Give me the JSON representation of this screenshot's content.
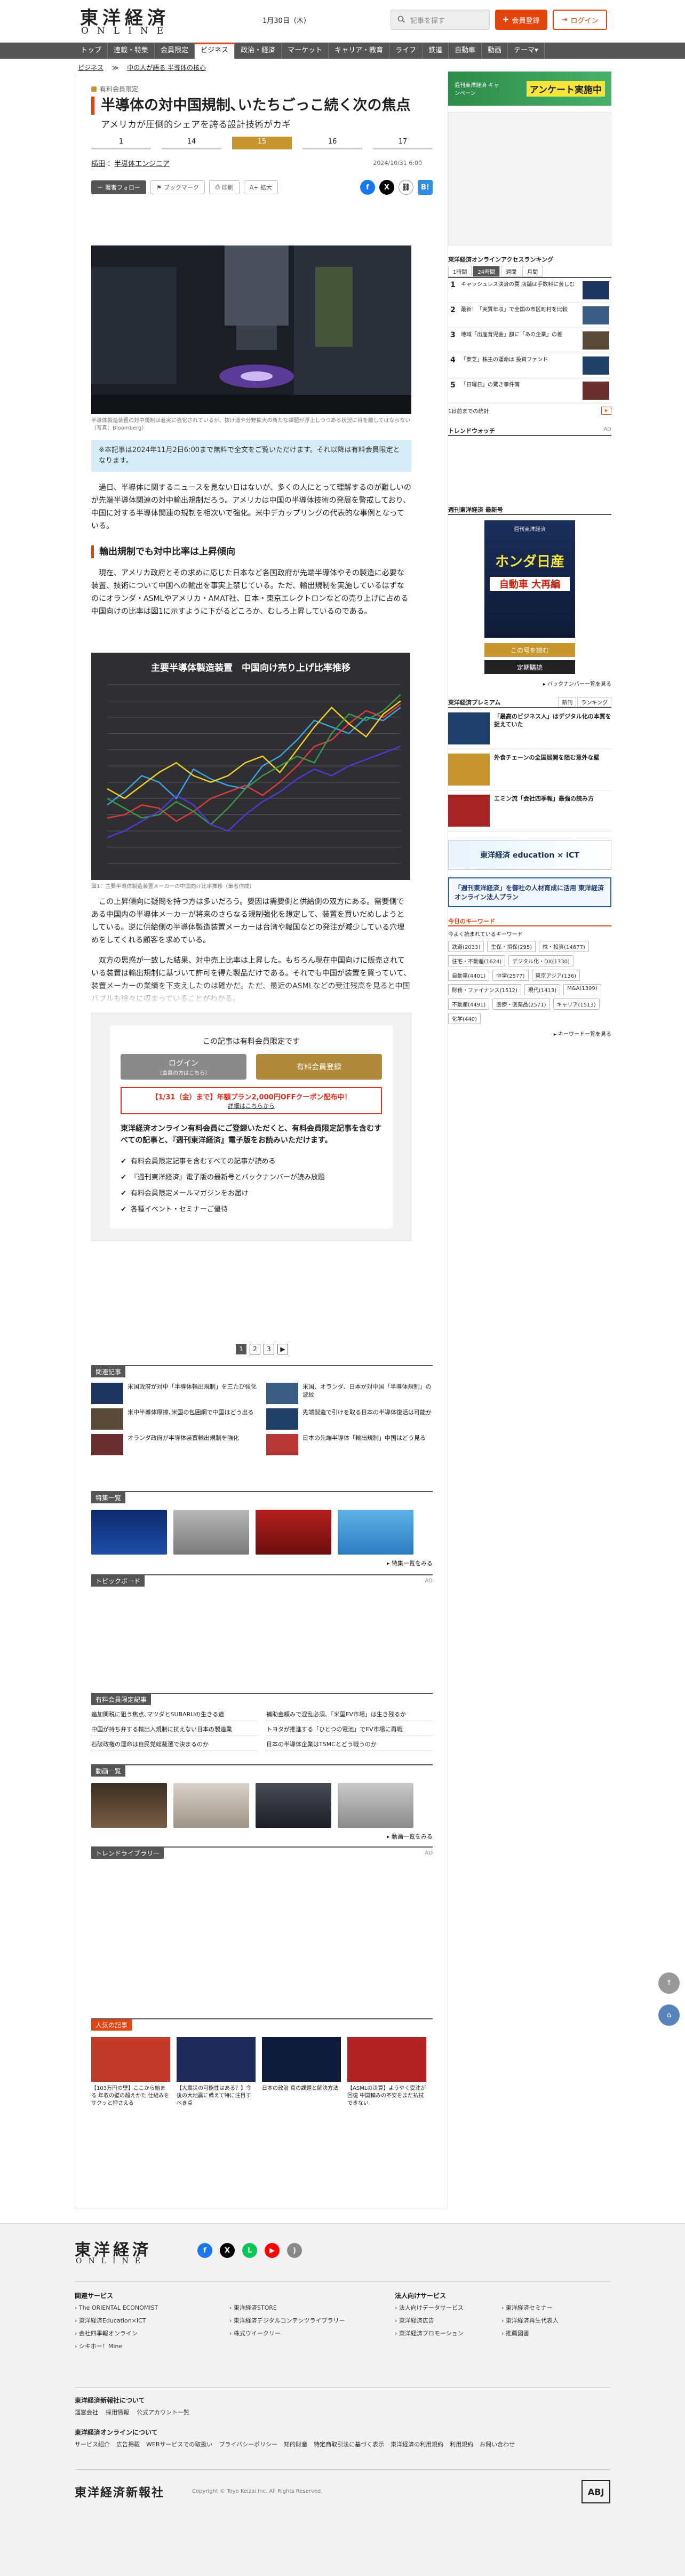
{
  "header": {
    "logo_main": "東洋経済",
    "logo_sub": "ONLINE",
    "date": "1月30日（木）",
    "search_placeholder": "記事を探す",
    "register_label": "会員登録",
    "login_label": "ログイン"
  },
  "nav": [
    "トップ",
    "連載・特集",
    "会員限定",
    "ビジネス",
    "政治・経済",
    "マーケット",
    "キャリア・教育",
    "ライフ",
    "鉄道",
    "自動車",
    "動画",
    "テーマ▾"
  ],
  "nav_active": "ビジネス",
  "breadcrumb": [
    "ビジネス",
    "≫",
    "中の人が語る 半導体の核心"
  ],
  "article": {
    "kicker": "有料会員限定",
    "title_line1": "半導体の対中国規制､いたちごっこ続く次の焦点",
    "subtitle": "アメリカが圧倒的シェアを誇る設計技術がカギ",
    "pages": [
      "1",
      "14",
      "15",
      "16",
      "17"
    ],
    "page_active": "15",
    "author_prefix": "横田",
    "author_name": "半導体エンジニア",
    "date": "2024/10/31 6:00",
    "follow_label": "著者フォロー",
    "bookmark_label": "ブックマーク",
    "print_label": "印刷",
    "textsize_label": "A+ 拡大",
    "photo_caption": "半導体製造装置の対中規制は着実に強化されているが、抜け道や分野拡大の新たな課題が浮上しつつある状況に目を離してはならない（写真：Bloomberg）",
    "note": "※本記事は2024年11月2日6:00まで無料で全文をご覧いただけます。それ以降は有料会員限定となります。",
    "para1": "過日、半導体に関するニュースを見ない日はないが、多くの人にとって理解するのが難しいのが先端半導体関連の対中輸出規制だろう。アメリカは中国の半導体技術の発展を警戒しており、中国に対する半導体関連の規制を相次いで強化。米中デカップリングの代表的な事例となっている。",
    "h2": "輸出規制でも対中比率は上昇傾向",
    "para2": "現在、アメリカ政府とその求めに応じた日本など各国政府が先端半導体やその製造に必要な装置、技術について中国への輸出を事実上禁じている。ただ、輸出規制を実施しているはずなのにオランダ・ASMLやアメリカ・AMAT社、日本・東京エレクトロンなどの売り上げに占める中国向けの比率は図1に示すように下がるどころか、むしろ上昇しているのである。",
    "para3": "この上昇傾向に疑問を持つ方は多いだろう。要因は需要側と供給側の双方にある。需要側である中国内の半導体メーカーが将来のさらなる規制強化を想定して、装置を買いだめしようとしている。逆に供給側の半導体製造装置メーカーは台湾や韓国などの発注が減少している穴埋めをしてくれる顧客を求めている。",
    "para4": "双方の思惑が一致した結果、対中売上比率は上昇した。もちろん現在中国向けに販売されている装置は輸出規制に基づいて許可を得た製品だけである。それでも中国が装置を買っていて、装置メーカーの業績を下支えしたのは確かだ。ただ、最近のASMLなどの受注残高を見ると中国バブルも徐々に収まっていることがわかる。"
  },
  "chart_data": {
    "type": "line",
    "title": "主要半導体製造装置　中国向け売り上げ比率推移",
    "caption": "図1：主要半導体製造装置メーカーの中国向け比率推移（筆者作成）",
    "series": [
      {
        "name": "",
        "color": "#3ba3e0",
        "values": [
          18,
          22,
          27,
          25,
          20,
          29,
          26,
          24,
          23,
          30,
          33,
          38,
          44,
          42,
          40,
          45,
          44,
          48
        ]
      },
      {
        "name": "",
        "color": "#e03c3c",
        "values": [
          14,
          15,
          18,
          17,
          13,
          16,
          20,
          22,
          24,
          21,
          25,
          30,
          36,
          38,
          43,
          47,
          45,
          49
        ]
      },
      {
        "name": "",
        "color": "#f2d21b",
        "values": [
          23,
          20,
          24,
          28,
          31,
          27,
          25,
          27,
          31,
          33,
          28,
          35,
          42,
          48,
          43,
          39,
          46,
          50
        ]
      },
      {
        "name": "",
        "color": "#3b9a45",
        "values": [
          20,
          17,
          14,
          15,
          19,
          16,
          12,
          17,
          23,
          27,
          30,
          33,
          31,
          40,
          46,
          44,
          47,
          52
        ]
      },
      {
        "name": "",
        "color": "#4b3bd8",
        "values": [
          8,
          10,
          13,
          16,
          21,
          18,
          12,
          10,
          15,
          19,
          22,
          26,
          29,
          27,
          30,
          32,
          34,
          36
        ]
      }
    ],
    "grid": true
  },
  "paywall": {
    "heading": "この記事は有料会員限定です",
    "login_label": "ログイン",
    "login_sub": "（会員の方はこちら）",
    "register_label": "有料会員登録",
    "promo": "【1/31（金）まで】年額プラン2,000円OFFクーポン配布中！",
    "promo_sub": "詳細はこちらから",
    "lead": "東洋経済オンライン有料会員にご登録いただくと、有料会員限定記事を含むすべての記事と、『週刊東洋経済』電子版をお読みいただけます。",
    "benefits": [
      "有料会員限定記事を含むすべての記事が読める",
      "『週刊東洋経済』電子版の最新号とバックナンバーが読み放題",
      "有料会員限定メールマガジンをお届け",
      "各種イベント・セミナーご優待"
    ]
  },
  "pagination": [
    "1",
    "2",
    "3",
    "▶"
  ],
  "related": {
    "heading": "関連記事",
    "items": [
      "米国政府が対中「半導体輸出規制」を三たび強化",
      "米国、オランダ、日本が対中国「半導体規制」の波紋",
      "米中半導体摩擦､米国の包囲網で中国はどう出る",
      "先端製造で引けを取る日本の半導体復活は可能か",
      "オランダ政府が半導体装置輸出規制を強化",
      "日本の先端半導体「輸出規制」中国はどう見る"
    ]
  },
  "feature": {
    "heading": "特集一覧",
    "more": "特集一覧をみる"
  },
  "topics": {
    "heading": "トピックボード",
    "ad": "AD"
  },
  "paid": {
    "heading": "有料会員限定記事",
    "items": [
      "追加関税に狙う焦点､マツダとSUBARUの生きる道",
      "補助金頼みで混乱必須､「米国EV市場」は生き残るか",
      "中国が持ち弁する輸出入規制に抗えない日本の製造業",
      "トヨタが推進する「ひとつの電池」でEV市場に再戦",
      "石破政権の運命は自民党総裁選で決まるのか",
      "日本の半導体企業はTSMCとどう戦うのか"
    ]
  },
  "video": {
    "heading": "動画一覧",
    "more": "動画一覧をみる"
  },
  "trend": {
    "heading": "トレンドライブラリー",
    "ad": "AD"
  },
  "popular": {
    "heading": "人気の記事",
    "items": [
      "【103万円の壁】ここから始まる 年収の壁の超えかた 仕組みをサクッと押さえる",
      "【大震災の可能性はある？】今後の大地震に備えて特に注目すべき点",
      "日本の政治 真の課題と解決方法",
      "【ASMLの決算】ようやく受注が回復 中国頼みの不安をまだ払拭できない"
    ]
  },
  "sidebar": {
    "ad_banner": "アンケート実施中",
    "ad_banner_sub": "週刊東洋経済 キャンペーン",
    "ranking_heading": "東洋経済オンラインアクセスランキング",
    "ranking_tabs": [
      "1時間",
      "24時間",
      "週間",
      "月間"
    ],
    "ranking": [
      "キャッシュレス決済の罠 店舗は手数料に苦しむ",
      "最新！「実質年収」で全国の市区町村を比較",
      "地域「出産育児金」額に「あの企業」の差",
      "「東芝」株主の運命は 投資ファンド",
      "「日曜日」の驚き事件簿"
    ],
    "ranking_more": "1日前までの統計",
    "trend_heading": "トレンドウォッチ",
    "trend_ad": "AD",
    "magazine_heading": "週刊東洋経済 最新号",
    "magazine_title": "ホンダ日産",
    "magazine_sub": "自動車 大再編",
    "magazine_btn1": "この号を読む",
    "magazine_btn2": "定期購読",
    "magazine_more": "バックナンバー一覧を見る",
    "premium_heading": "東洋経済プレミアム",
    "premium_tabs": [
      "新刊",
      "ランキング"
    ],
    "premium_items": [
      "「最高のビジネス人」はデジタル化の本質を捉えていた",
      "外食チェーンの全国展開を阻む意外な壁",
      "エミン流「会社四季報」最強の読み方"
    ],
    "edu_banner": "東洋経済 education × ICT",
    "corp_banner": "「週刊東洋経済」を御社の人材育成に活用 東洋経済オンライン法人プラン",
    "keyword_heading": "今日のキーワード",
    "keyword_sub": "今よく読まれているキーワード",
    "keywords": [
      "鉄道(2033)",
      "生保・損保(295)",
      "株・投資(14677)",
      "住宅・不動産(1624)",
      "デジタル化・DX(1330)",
      "自動車(4401)",
      "中学(2577)",
      "東京アジア(136)",
      "財務・ファイナンス(1512)",
      "現代(1413)",
      "M&A(1399)",
      "不動産(4491)",
      "医療・医薬品(2571)",
      "キャリア(1513)",
      "化学(440)"
    ],
    "keyword_more": "キーワード一覧を見る"
  },
  "footer": {
    "logo_main": "東洋経済",
    "logo_sub": "ONLINE",
    "services_heading": "関連サービス",
    "services": [
      "The ORIENTAL ECONOMIST",
      "東洋経済Education×ICT",
      "会社四季報オンライン",
      "シキホー！Mine",
      "東洋経済STORE",
      "東洋経済デジタルコンテンツライブラリー",
      "株式ウイークリー"
    ],
    "corp_heading": "法人向けサービス",
    "corp": [
      "法人向けデータサービス",
      "東洋経済広告",
      "東洋経済プロモーション",
      "東洋経済セミナー",
      "東洋経済再生代表人",
      "推薦図書"
    ],
    "about_heading": "東洋経済新報社について",
    "about": [
      "運営会社",
      "採用情報",
      "公式アカウント一覧"
    ],
    "online_heading": "東洋経済オンラインについて",
    "online": [
      "サービス紹介",
      "広告掲載",
      "WEBサービスでの取扱い",
      "プライバシーポリシー",
      "知的財産",
      "特定商取引法に基づく表示",
      "東洋経済の利用規約",
      "利用規約",
      "お問い合わせ"
    ],
    "company": "東洋経済新報社",
    "copyright": "Copyright © Toyo Keizai Inc. All Rights Reserved.",
    "badge": "ABJ"
  },
  "colors": {
    "accent": "#e3450c",
    "gold": "#c8962e",
    "nav": "#555555",
    "note": "#d6edf8"
  }
}
